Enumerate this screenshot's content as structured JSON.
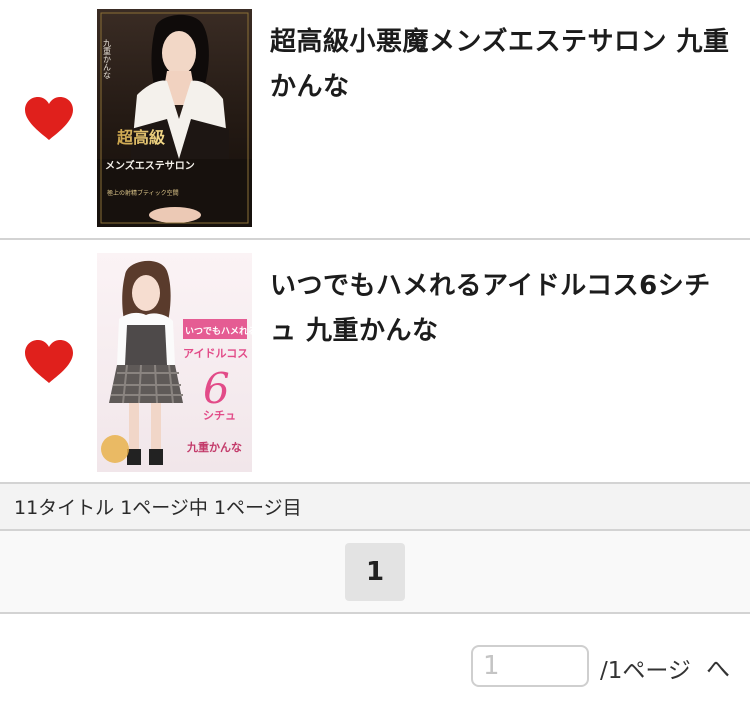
{
  "items": [
    {
      "title": "超高級小悪魔メンズエステサロン 九重かんな",
      "favorite_icon": "heart-icon",
      "favorite_color": "#e0201c",
      "cover": {
        "actress_name": "九重かんな",
        "line1": "超高級",
        "line2": "メンズエステサロン",
        "line3": "極上の射精ブティック空間"
      }
    },
    {
      "title": "いつでもハメれるアイドルコス6シチュ 九重かんな",
      "favorite_icon": "heart-icon",
      "favorite_color": "#e0201c",
      "cover": {
        "actress_name": "九重かんな",
        "headline": "いつでもハメれる",
        "subtitle": "アイドルコス",
        "number": "6",
        "suffix": "シチュ"
      }
    }
  ],
  "summary": "11タイトル 1ページ中 1ページ目",
  "pagination": {
    "current_page": "1"
  },
  "page_jump": {
    "placeholder": "1",
    "suffix": "/1ページ",
    "go_label": "へ"
  }
}
